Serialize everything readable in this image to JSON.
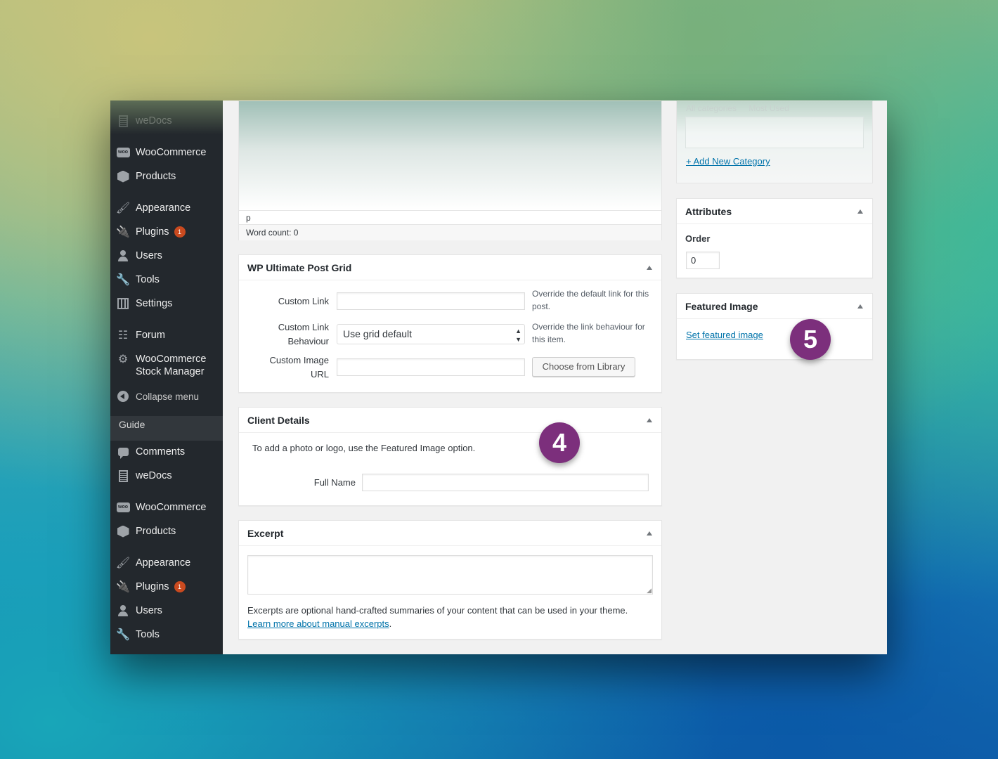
{
  "sidebar": {
    "items": [
      {
        "label": "weDocs",
        "icon": "docs-icon"
      },
      {
        "label": "WooCommerce",
        "icon": "woo-icon"
      },
      {
        "label": "Products",
        "icon": "products-icon"
      },
      {
        "label": "Appearance",
        "icon": "appearance-brush-icon"
      },
      {
        "label": "Plugins",
        "icon": "plugins-icon",
        "badge": "1"
      },
      {
        "label": "Users",
        "icon": "users-icon"
      },
      {
        "label": "Tools",
        "icon": "tools-wrench-icon"
      },
      {
        "label": "Settings",
        "icon": "settings-icon"
      },
      {
        "label": "Forum",
        "icon": "forum-icon"
      },
      {
        "label": "WooCommerce",
        "label2": "Stock Manager",
        "icon": "gear-icon"
      },
      {
        "label": "Collapse menu",
        "icon": "collapse-icon"
      }
    ],
    "guide_label": "Guide",
    "items2": [
      {
        "label": "Comments",
        "icon": "comments-icon"
      },
      {
        "label": "weDocs",
        "icon": "docs-icon"
      },
      {
        "label": "WooCommerce",
        "icon": "woo-icon"
      },
      {
        "label": "Products",
        "icon": "products-icon"
      },
      {
        "label": "Appearance",
        "icon": "appearance-brush-icon"
      },
      {
        "label": "Plugins",
        "icon": "plugins-icon",
        "badge": "1"
      },
      {
        "label": "Users",
        "icon": "users-icon"
      },
      {
        "label": "Tools",
        "icon": "tools-wrench-icon"
      }
    ]
  },
  "editor": {
    "path": "p",
    "word_count": "Word count: 0"
  },
  "post_grid": {
    "title": "WP Ultimate Post Grid",
    "custom_link_label": "Custom Link",
    "custom_link_desc": "Override the default link for this post.",
    "link_behaviour_label": "Custom Link Behaviour",
    "link_behaviour_value": "Use grid default",
    "link_behaviour_desc": "Override the link behaviour for this item.",
    "image_url_label": "Custom Image URL",
    "choose_button": "Choose from Library"
  },
  "client_details": {
    "title": "Client Details",
    "note": "To add a photo or logo, use the Featured Image option.",
    "full_name_label": "Full Name"
  },
  "excerpt": {
    "title": "Excerpt",
    "help_text": "Excerpts are optional hand-crafted summaries of your content that can be used in your theme.",
    "learn_more_link": "Learn more about manual excerpts"
  },
  "categories": {
    "tab_all": "All categories",
    "tab_most_used": "Most Used",
    "add_new": "+ Add New Category"
  },
  "attributes": {
    "title": "Attributes",
    "order_label": "Order",
    "order_value": "0"
  },
  "featured_image": {
    "title": "Featured Image",
    "set_link": "Set featured image"
  },
  "steps": {
    "four": "4",
    "five": "5"
  },
  "colors": {
    "sidebar_bg": "#23282d",
    "badge": "#ca4a1f",
    "step_badge": "#7c2f7c",
    "link": "#0073aa"
  }
}
